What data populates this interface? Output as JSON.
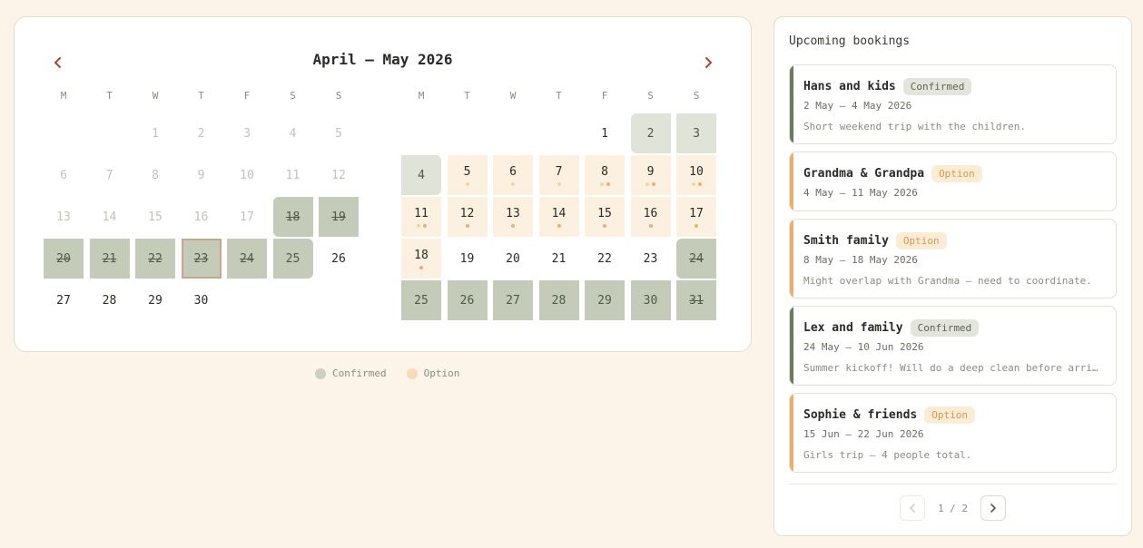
{
  "calendar": {
    "title": "April – May 2026",
    "prev_icon": "chevron-left-icon",
    "next_icon": "chevron-right-icon",
    "weekday_labels": [
      "M",
      "T",
      "W",
      "T",
      "F",
      "S",
      "S"
    ],
    "months": [
      {
        "name": "April 2026",
        "days": [
          {
            "d": "1",
            "col": 2,
            "row": 0,
            "state": "muted"
          },
          {
            "d": "2",
            "col": 3,
            "row": 0,
            "state": "muted"
          },
          {
            "d": "3",
            "col": 4,
            "row": 0,
            "state": "muted"
          },
          {
            "d": "4",
            "col": 5,
            "row": 0,
            "state": "muted"
          },
          {
            "d": "5",
            "col": 6,
            "row": 0,
            "state": "muted"
          },
          {
            "d": "6",
            "col": 0,
            "row": 1,
            "state": "muted"
          },
          {
            "d": "7",
            "col": 1,
            "row": 1,
            "state": "muted"
          },
          {
            "d": "8",
            "col": 2,
            "row": 1,
            "state": "muted"
          },
          {
            "d": "9",
            "col": 3,
            "row": 1,
            "state": "muted"
          },
          {
            "d": "10",
            "col": 4,
            "row": 1,
            "state": "muted"
          },
          {
            "d": "11",
            "col": 5,
            "row": 1,
            "state": "muted"
          },
          {
            "d": "12",
            "col": 6,
            "row": 1,
            "state": "muted"
          },
          {
            "d": "13",
            "col": 0,
            "row": 2,
            "state": "muted"
          },
          {
            "d": "14",
            "col": 1,
            "row": 2,
            "state": "muted"
          },
          {
            "d": "15",
            "col": 2,
            "row": 2,
            "state": "muted"
          },
          {
            "d": "16",
            "col": 3,
            "row": 2,
            "state": "muted"
          },
          {
            "d": "17",
            "col": 4,
            "row": 2,
            "state": "muted"
          },
          {
            "d": "18",
            "col": 5,
            "row": 2,
            "state": "confirmed",
            "strike": true,
            "rl": true
          },
          {
            "d": "19",
            "col": 6,
            "row": 2,
            "state": "confirmed",
            "strike": true
          },
          {
            "d": "20",
            "col": 0,
            "row": 3,
            "state": "confirmed",
            "strike": true
          },
          {
            "d": "21",
            "col": 1,
            "row": 3,
            "state": "confirmed",
            "strike": true
          },
          {
            "d": "22",
            "col": 2,
            "row": 3,
            "state": "confirmed",
            "strike": true
          },
          {
            "d": "23",
            "col": 3,
            "row": 3,
            "state": "confirmed",
            "strike": true,
            "today": true
          },
          {
            "d": "24",
            "col": 4,
            "row": 3,
            "state": "confirmed",
            "strike": true
          },
          {
            "d": "25",
            "col": 5,
            "row": 3,
            "state": "confirmed",
            "rr": true
          },
          {
            "d": "26",
            "col": 6,
            "row": 3,
            "state": "normal"
          },
          {
            "d": "27",
            "col": 0,
            "row": 4,
            "state": "normal"
          },
          {
            "d": "28",
            "col": 1,
            "row": 4,
            "state": "normal"
          },
          {
            "d": "29",
            "col": 2,
            "row": 4,
            "state": "normal"
          },
          {
            "d": "30",
            "col": 3,
            "row": 4,
            "state": "normal"
          }
        ]
      },
      {
        "name": "May 2026",
        "days": [
          {
            "d": "1",
            "col": 4,
            "row": 0,
            "state": "normal"
          },
          {
            "d": "2",
            "col": 5,
            "row": 0,
            "state": "confirmed-light",
            "rl": true
          },
          {
            "d": "3",
            "col": 6,
            "row": 0,
            "state": "confirmed-light"
          },
          {
            "d": "4",
            "col": 0,
            "row": 1,
            "state": "confirmed-light",
            "rr": true
          },
          {
            "d": "5",
            "col": 1,
            "row": 1,
            "state": "option",
            "dots": [
              "ol"
            ]
          },
          {
            "d": "6",
            "col": 2,
            "row": 1,
            "state": "option",
            "dots": [
              "ol"
            ]
          },
          {
            "d": "7",
            "col": 3,
            "row": 1,
            "state": "option",
            "dots": [
              "ol"
            ]
          },
          {
            "d": "8",
            "col": 4,
            "row": 1,
            "state": "option",
            "dots": [
              "ol",
              "o"
            ]
          },
          {
            "d": "9",
            "col": 5,
            "row": 1,
            "state": "option",
            "dots": [
              "ol",
              "o"
            ]
          },
          {
            "d": "10",
            "col": 6,
            "row": 1,
            "state": "option",
            "dots": [
              "ol",
              "o"
            ]
          },
          {
            "d": "11",
            "col": 0,
            "row": 2,
            "state": "option",
            "dots": [
              "ol",
              "o"
            ]
          },
          {
            "d": "12",
            "col": 1,
            "row": 2,
            "state": "option",
            "dots": [
              "o"
            ]
          },
          {
            "d": "13",
            "col": 2,
            "row": 2,
            "state": "option",
            "dots": [
              "o"
            ]
          },
          {
            "d": "14",
            "col": 3,
            "row": 2,
            "state": "option",
            "dots": [
              "o"
            ]
          },
          {
            "d": "15",
            "col": 4,
            "row": 2,
            "state": "option",
            "dots": [
              "o"
            ]
          },
          {
            "d": "16",
            "col": 5,
            "row": 2,
            "state": "option",
            "dots": [
              "o"
            ]
          },
          {
            "d": "17",
            "col": 6,
            "row": 2,
            "state": "option",
            "dots": [
              "o"
            ]
          },
          {
            "d": "18",
            "col": 0,
            "row": 3,
            "state": "option",
            "dots": [
              "o"
            ]
          },
          {
            "d": "19",
            "col": 1,
            "row": 3,
            "state": "normal"
          },
          {
            "d": "20",
            "col": 2,
            "row": 3,
            "state": "normal"
          },
          {
            "d": "21",
            "col": 3,
            "row": 3,
            "state": "normal"
          },
          {
            "d": "22",
            "col": 4,
            "row": 3,
            "state": "normal"
          },
          {
            "d": "23",
            "col": 5,
            "row": 3,
            "state": "normal"
          },
          {
            "d": "24",
            "col": 6,
            "row": 3,
            "state": "confirmed",
            "strike": true,
            "rl": true
          },
          {
            "d": "25",
            "col": 0,
            "row": 4,
            "state": "confirmed"
          },
          {
            "d": "26",
            "col": 1,
            "row": 4,
            "state": "confirmed"
          },
          {
            "d": "27",
            "col": 2,
            "row": 4,
            "state": "confirmed"
          },
          {
            "d": "28",
            "col": 3,
            "row": 4,
            "state": "confirmed"
          },
          {
            "d": "29",
            "col": 4,
            "row": 4,
            "state": "confirmed"
          },
          {
            "d": "30",
            "col": 5,
            "row": 4,
            "state": "confirmed"
          },
          {
            "d": "31",
            "col": 6,
            "row": 4,
            "state": "confirmed",
            "strike": true
          }
        ]
      }
    ]
  },
  "legend": [
    {
      "label": "Confirmed",
      "color": "#cdcfc0"
    },
    {
      "label": "Option",
      "color": "#f8dcb8"
    }
  ],
  "bookings_panel": {
    "title": "Upcoming bookings",
    "items": [
      {
        "name": "Hans and kids",
        "status": "Confirmed",
        "type": "confirmed",
        "dates": "2 May – 4 May 2026",
        "note": "Short weekend trip with the children."
      },
      {
        "name": "Grandma & Grandpa",
        "status": "Option",
        "type": "option",
        "dates": "4 May – 11 May 2026",
        "note": ""
      },
      {
        "name": "Smith family",
        "status": "Option",
        "type": "option",
        "dates": "8 May – 18 May 2026",
        "note": "Might overlap with Grandma — need to coordinate."
      },
      {
        "name": "Lex and family",
        "status": "Confirmed",
        "type": "confirmed",
        "dates": "24 May – 10 Jun 2026",
        "note": "Summer kickoff! Will do a deep clean before arri…"
      },
      {
        "name": "Sophie & friends",
        "status": "Option",
        "type": "option",
        "dates": "15 Jun – 22 Jun 2026",
        "note": "Girls trip — 4 people total."
      }
    ],
    "pager": {
      "text": "1 / 2",
      "prev_icon": "chevron-left-icon",
      "next_icon": "chevron-right-icon"
    }
  },
  "colors": {
    "background": "#fcf4e9",
    "confirmed_accent": "#6b7a5e",
    "option_accent": "#e8b06a",
    "nav_arrow": "#b5452f"
  }
}
